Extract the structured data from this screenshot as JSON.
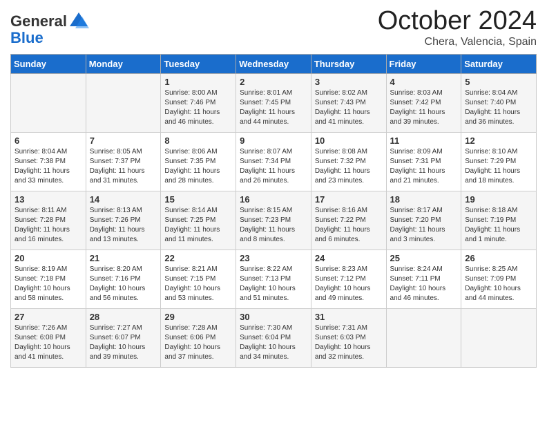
{
  "header": {
    "logo_general": "General",
    "logo_blue": "Blue",
    "month": "October 2024",
    "location": "Chera, Valencia, Spain"
  },
  "days_of_week": [
    "Sunday",
    "Monday",
    "Tuesday",
    "Wednesday",
    "Thursday",
    "Friday",
    "Saturday"
  ],
  "weeks": [
    [
      {
        "day": "",
        "info": ""
      },
      {
        "day": "",
        "info": ""
      },
      {
        "day": "1",
        "info": "Sunrise: 8:00 AM\nSunset: 7:46 PM\nDaylight: 11 hours and 46 minutes."
      },
      {
        "day": "2",
        "info": "Sunrise: 8:01 AM\nSunset: 7:45 PM\nDaylight: 11 hours and 44 minutes."
      },
      {
        "day": "3",
        "info": "Sunrise: 8:02 AM\nSunset: 7:43 PM\nDaylight: 11 hours and 41 minutes."
      },
      {
        "day": "4",
        "info": "Sunrise: 8:03 AM\nSunset: 7:42 PM\nDaylight: 11 hours and 39 minutes."
      },
      {
        "day": "5",
        "info": "Sunrise: 8:04 AM\nSunset: 7:40 PM\nDaylight: 11 hours and 36 minutes."
      }
    ],
    [
      {
        "day": "6",
        "info": "Sunrise: 8:04 AM\nSunset: 7:38 PM\nDaylight: 11 hours and 33 minutes."
      },
      {
        "day": "7",
        "info": "Sunrise: 8:05 AM\nSunset: 7:37 PM\nDaylight: 11 hours and 31 minutes."
      },
      {
        "day": "8",
        "info": "Sunrise: 8:06 AM\nSunset: 7:35 PM\nDaylight: 11 hours and 28 minutes."
      },
      {
        "day": "9",
        "info": "Sunrise: 8:07 AM\nSunset: 7:34 PM\nDaylight: 11 hours and 26 minutes."
      },
      {
        "day": "10",
        "info": "Sunrise: 8:08 AM\nSunset: 7:32 PM\nDaylight: 11 hours and 23 minutes."
      },
      {
        "day": "11",
        "info": "Sunrise: 8:09 AM\nSunset: 7:31 PM\nDaylight: 11 hours and 21 minutes."
      },
      {
        "day": "12",
        "info": "Sunrise: 8:10 AM\nSunset: 7:29 PM\nDaylight: 11 hours and 18 minutes."
      }
    ],
    [
      {
        "day": "13",
        "info": "Sunrise: 8:11 AM\nSunset: 7:28 PM\nDaylight: 11 hours and 16 minutes."
      },
      {
        "day": "14",
        "info": "Sunrise: 8:13 AM\nSunset: 7:26 PM\nDaylight: 11 hours and 13 minutes."
      },
      {
        "day": "15",
        "info": "Sunrise: 8:14 AM\nSunset: 7:25 PM\nDaylight: 11 hours and 11 minutes."
      },
      {
        "day": "16",
        "info": "Sunrise: 8:15 AM\nSunset: 7:23 PM\nDaylight: 11 hours and 8 minutes."
      },
      {
        "day": "17",
        "info": "Sunrise: 8:16 AM\nSunset: 7:22 PM\nDaylight: 11 hours and 6 minutes."
      },
      {
        "day": "18",
        "info": "Sunrise: 8:17 AM\nSunset: 7:20 PM\nDaylight: 11 hours and 3 minutes."
      },
      {
        "day": "19",
        "info": "Sunrise: 8:18 AM\nSunset: 7:19 PM\nDaylight: 11 hours and 1 minute."
      }
    ],
    [
      {
        "day": "20",
        "info": "Sunrise: 8:19 AM\nSunset: 7:18 PM\nDaylight: 10 hours and 58 minutes."
      },
      {
        "day": "21",
        "info": "Sunrise: 8:20 AM\nSunset: 7:16 PM\nDaylight: 10 hours and 56 minutes."
      },
      {
        "day": "22",
        "info": "Sunrise: 8:21 AM\nSunset: 7:15 PM\nDaylight: 10 hours and 53 minutes."
      },
      {
        "day": "23",
        "info": "Sunrise: 8:22 AM\nSunset: 7:13 PM\nDaylight: 10 hours and 51 minutes."
      },
      {
        "day": "24",
        "info": "Sunrise: 8:23 AM\nSunset: 7:12 PM\nDaylight: 10 hours and 49 minutes."
      },
      {
        "day": "25",
        "info": "Sunrise: 8:24 AM\nSunset: 7:11 PM\nDaylight: 10 hours and 46 minutes."
      },
      {
        "day": "26",
        "info": "Sunrise: 8:25 AM\nSunset: 7:09 PM\nDaylight: 10 hours and 44 minutes."
      }
    ],
    [
      {
        "day": "27",
        "info": "Sunrise: 7:26 AM\nSunset: 6:08 PM\nDaylight: 10 hours and 41 minutes."
      },
      {
        "day": "28",
        "info": "Sunrise: 7:27 AM\nSunset: 6:07 PM\nDaylight: 10 hours and 39 minutes."
      },
      {
        "day": "29",
        "info": "Sunrise: 7:28 AM\nSunset: 6:06 PM\nDaylight: 10 hours and 37 minutes."
      },
      {
        "day": "30",
        "info": "Sunrise: 7:30 AM\nSunset: 6:04 PM\nDaylight: 10 hours and 34 minutes."
      },
      {
        "day": "31",
        "info": "Sunrise: 7:31 AM\nSunset: 6:03 PM\nDaylight: 10 hours and 32 minutes."
      },
      {
        "day": "",
        "info": ""
      },
      {
        "day": "",
        "info": ""
      }
    ]
  ]
}
